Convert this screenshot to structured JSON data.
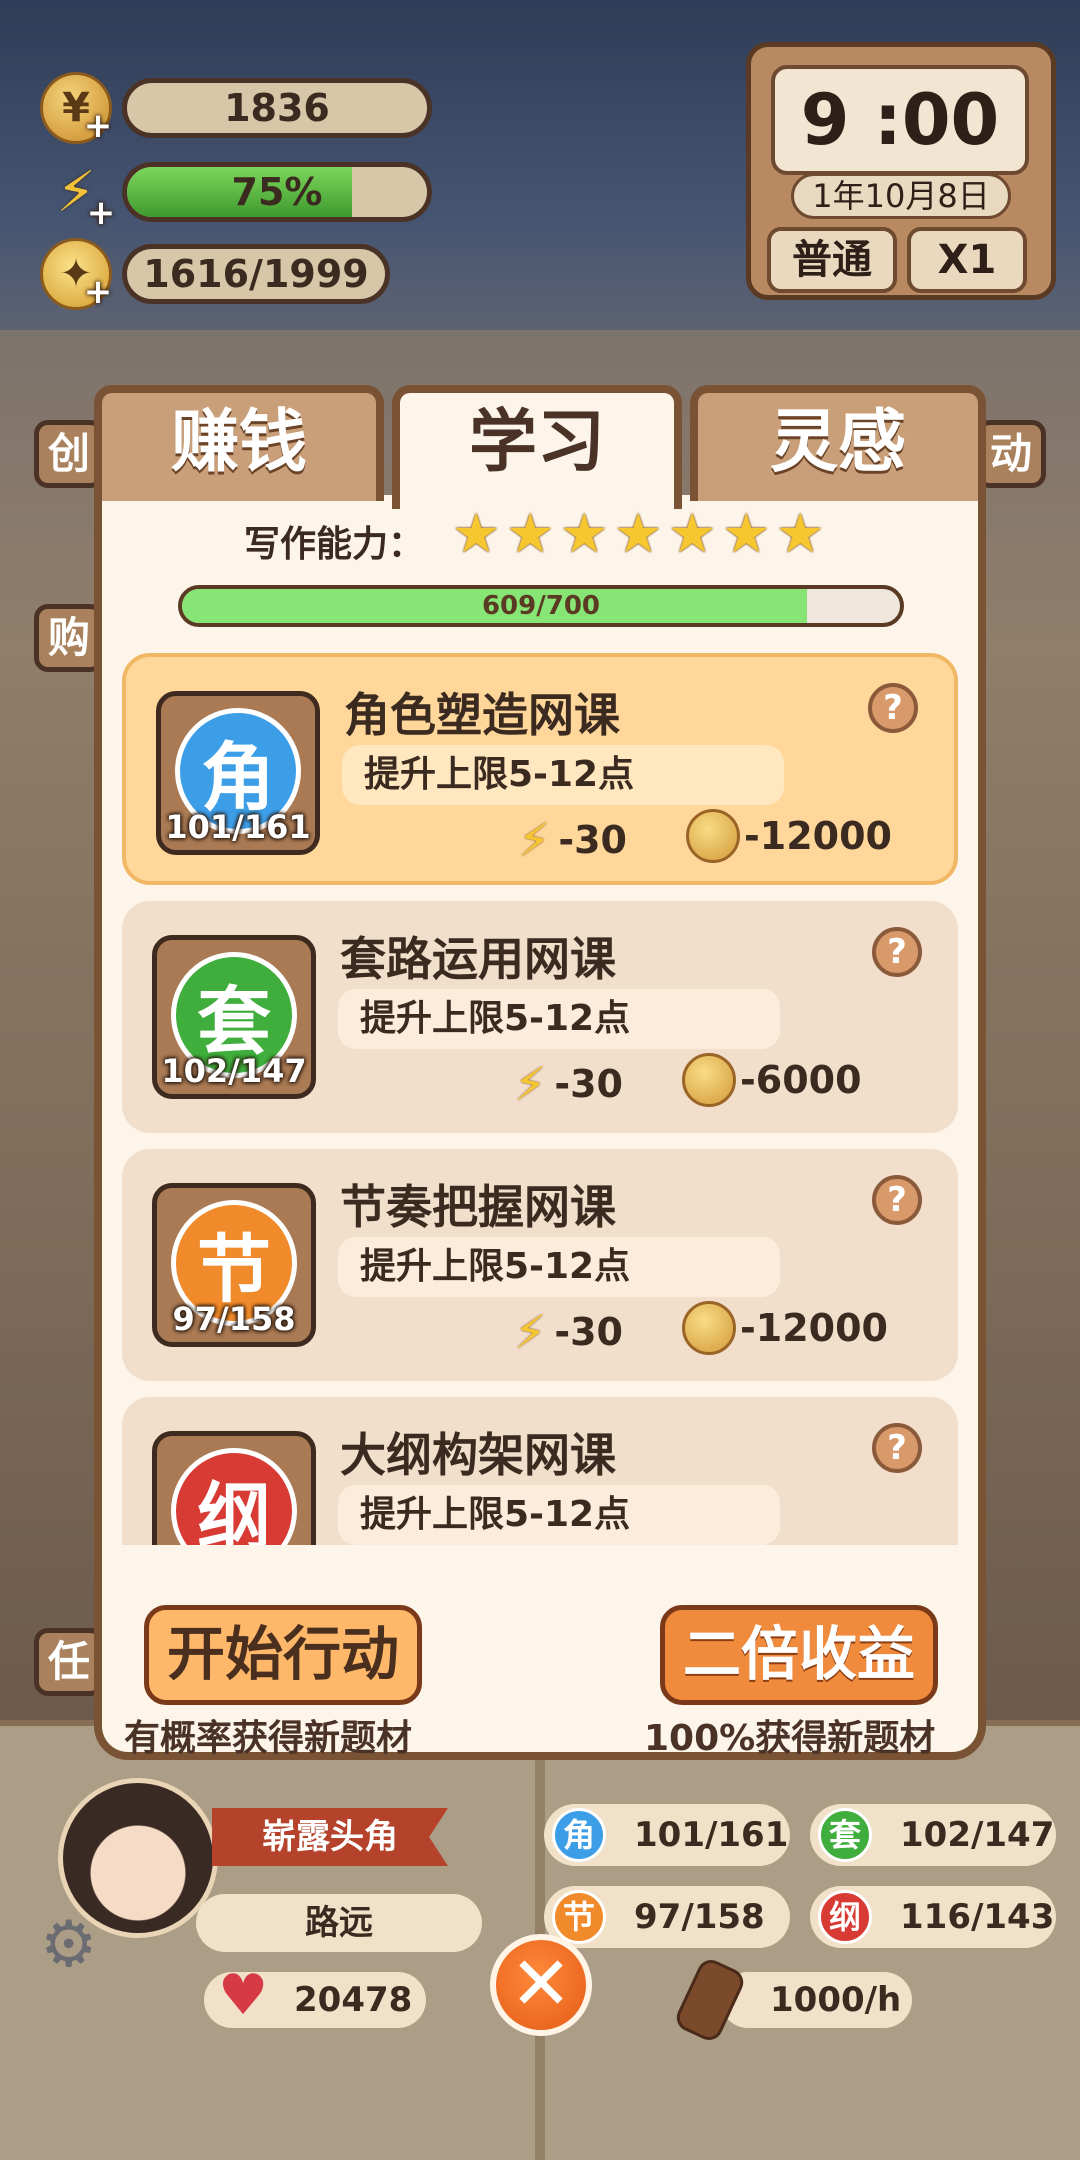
{
  "resources": {
    "coins": "1836",
    "energy_text": "75%",
    "energy_fraction": 0.75,
    "ideas": "1616/1999"
  },
  "clock": {
    "time": "9 :00",
    "date": "1年10月8日",
    "mode": "普通",
    "speed": "X1"
  },
  "tabs": [
    {
      "label": "赚钱",
      "active": false
    },
    {
      "label": "学习",
      "active": true
    },
    {
      "label": "灵感",
      "active": false
    }
  ],
  "skill": {
    "label": "写作能力：",
    "stars": 7,
    "progress_text": "609/700",
    "progress_fraction": 0.87
  },
  "courses": [
    {
      "badge": "角",
      "color": "#3d9ee8",
      "count": "101/161",
      "title": "角色塑造网课",
      "desc": "提升上限5-12点",
      "energy": "-30",
      "coins": "-12000",
      "selected": true
    },
    {
      "badge": "套",
      "color": "#3fae3c",
      "count": "102/147",
      "title": "套路运用网课",
      "desc": "提升上限5-12点",
      "energy": "-30",
      "coins": "-6000",
      "selected": false
    },
    {
      "badge": "节",
      "color": "#f08a2a",
      "count": "97/158",
      "title": "节奏把握网课",
      "desc": "提升上限5-12点",
      "energy": "-30",
      "coins": "-12000",
      "selected": false
    },
    {
      "badge": "纲",
      "color": "#d83a34",
      "count": "",
      "title": "大纲构架网课",
      "desc": "提升上限5-12点",
      "energy": "",
      "coins": "",
      "selected": false
    }
  ],
  "actions": {
    "start_label": "开始行动",
    "start_note": "有概率获得新题材",
    "double_label": "二倍收益",
    "double_note": "100%获得新题材"
  },
  "side_labels": {
    "left1": "创",
    "left2": "购",
    "left3": "任",
    "right1": "动"
  },
  "profile": {
    "rank": "崭露头角",
    "name": "路远",
    "hearts": "20478",
    "rate": "1000/h",
    "close_glyph": "✕"
  },
  "stats": [
    {
      "badge": "角",
      "color": "#3d9ee8",
      "value": "101/161"
    },
    {
      "badge": "套",
      "color": "#3fae3c",
      "value": "102/147"
    },
    {
      "badge": "节",
      "color": "#f08a2a",
      "value": "97/158"
    },
    {
      "badge": "纲",
      "color": "#d83a34",
      "value": "116/143"
    }
  ]
}
